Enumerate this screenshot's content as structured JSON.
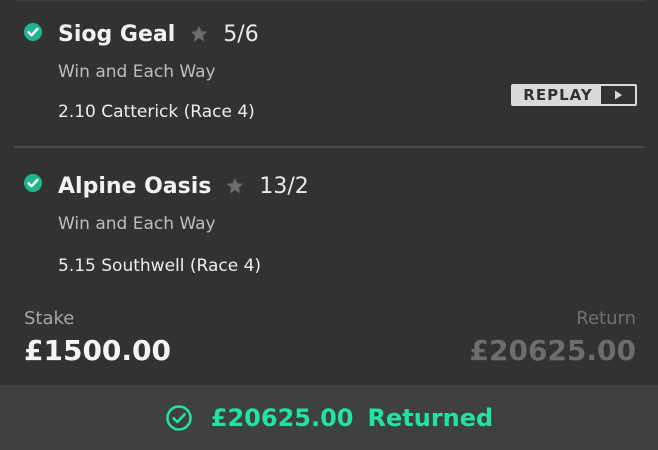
{
  "selections": [
    {
      "horse": "Siog Geal",
      "price": "5/6",
      "market": "Win and Each Way",
      "event": "2.10 Catterick (Race 4)",
      "replay_label": "REPLAY",
      "status_icon": "check-circle-icon"
    },
    {
      "horse": "Alpine Oasis",
      "price": "13/2",
      "market": "Win and Each Way",
      "event": "5.15 Southwell (Race 4)",
      "status_icon": "check-circle-icon"
    }
  ],
  "summary": {
    "stake_label": "Stake",
    "stake_value": "£1500.00",
    "return_label": "Return",
    "return_value": "£20625.00"
  },
  "footer": {
    "amount": "£20625.00",
    "status": "Returned"
  },
  "colors": {
    "win_green": "#1fb68b",
    "returned_green": "#22e3a3",
    "background": "#313332"
  }
}
